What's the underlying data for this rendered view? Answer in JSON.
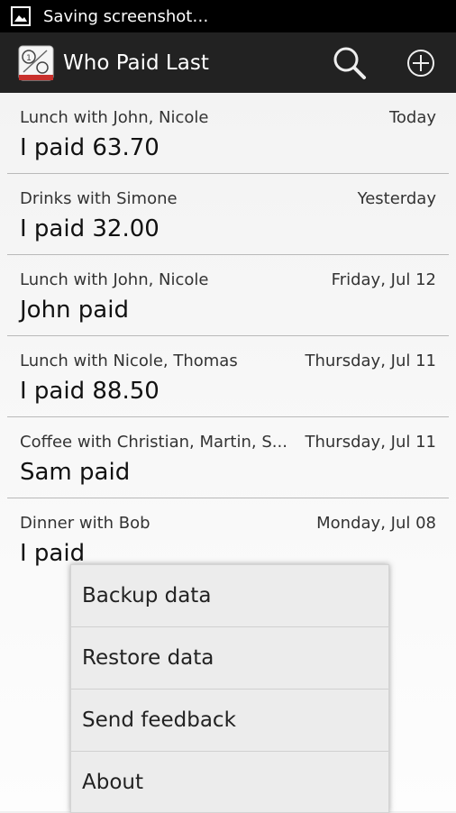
{
  "status_bar": {
    "notification": "Saving screenshot…"
  },
  "action_bar": {
    "title": "Who Paid Last"
  },
  "entries": [
    {
      "description": "Lunch with John, Nicole",
      "date": "Today",
      "amount": "I paid 63.70"
    },
    {
      "description": "Drinks with Simone",
      "date": "Yesterday",
      "amount": "I paid 32.00"
    },
    {
      "description": "Lunch with John, Nicole",
      "date": "Friday, Jul 12",
      "amount": "John paid"
    },
    {
      "description": "Lunch with Nicole, Thomas",
      "date": "Thursday, Jul 11",
      "amount": "I paid 88.50"
    },
    {
      "description": "Coffee with Christian, Martin, S...",
      "date": "Thursday, Jul 11",
      "amount": "Sam paid"
    },
    {
      "description": "Dinner with Bob",
      "date": "Monday, Jul 08",
      "amount": "I paid"
    }
  ],
  "overflow_menu": {
    "items": [
      "Backup data",
      "Restore data",
      "Send feedback",
      "About"
    ]
  },
  "colors": {
    "status_bar": "#000000",
    "action_bar": "#222222",
    "menu_bg": "#ececec"
  }
}
